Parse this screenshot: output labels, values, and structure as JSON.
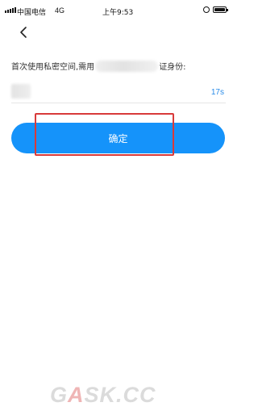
{
  "status_bar": {
    "carrier": "中国电信",
    "network": "4G",
    "time": "上午9:53"
  },
  "prompt": {
    "text_before": "首次使用私密空间,需用",
    "text_after": "证身份:"
  },
  "verification": {
    "countdown": "17s"
  },
  "confirm_button": {
    "label": "确定"
  },
  "watermark": {
    "prefix": "G",
    "accent": "A",
    "suffix": "SK.CC"
  },
  "colors": {
    "primary": "#1593fa",
    "link": "#2a8ce8",
    "highlight": "#d83a3a"
  }
}
